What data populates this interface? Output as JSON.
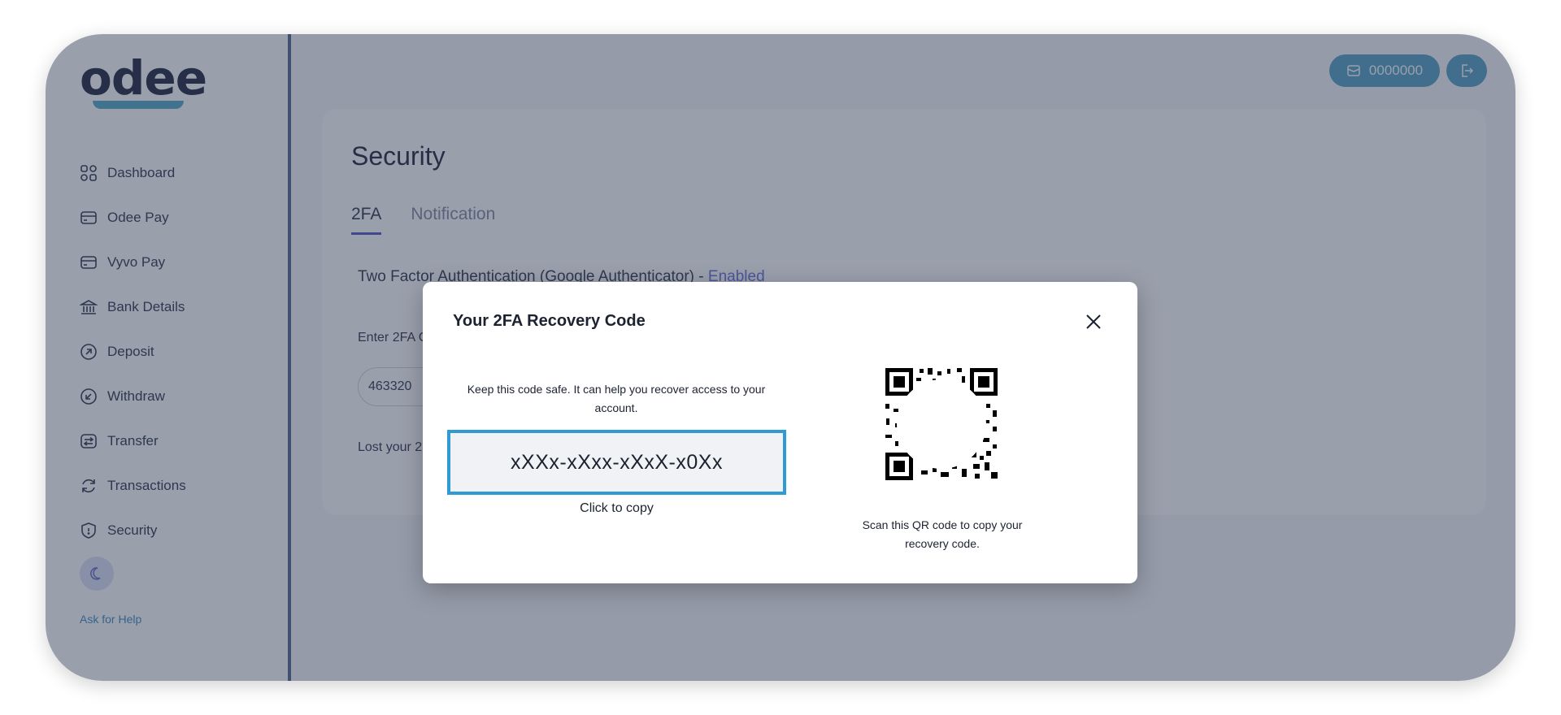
{
  "app": {
    "logo_text": "odee"
  },
  "sidebar": {
    "items": [
      {
        "label": "Dashboard",
        "icon": "grid-icon"
      },
      {
        "label": "Odee Pay",
        "icon": "card-icon"
      },
      {
        "label": "Vyvo Pay",
        "icon": "card-icon"
      },
      {
        "label": "Bank Details",
        "icon": "bank-icon"
      },
      {
        "label": "Deposit",
        "icon": "deposit-icon"
      },
      {
        "label": "Withdraw",
        "icon": "withdraw-icon"
      },
      {
        "label": "Transfer",
        "icon": "transfer-icon"
      },
      {
        "label": "Transactions",
        "icon": "refresh-icon"
      },
      {
        "label": "Security",
        "icon": "shield-icon"
      }
    ],
    "ask_help": "Ask for Help"
  },
  "header": {
    "balance": "0000000"
  },
  "main": {
    "title": "Security",
    "tabs": [
      {
        "label": "2FA",
        "active": true
      },
      {
        "label": "Notification",
        "active": false
      }
    ],
    "twofa_status_text": "Two Factor Authentication (Google Authenticator) - ",
    "twofa_status_value": "Enabled",
    "enter_label": "Enter 2FA C",
    "code_value": "463320",
    "lost_text": "Lost your 2"
  },
  "modal": {
    "title": "Your 2FA Recovery Code",
    "description": "Keep this code safe. It can help you recover access to your account.",
    "recovery_code": "xXXx-xXxx-xXxX-x0Xx",
    "copy_hint": "Click to copy",
    "qr_hint": "Scan this QR code to copy your recovery code."
  },
  "colors": {
    "accent": "#2f9ad3",
    "header_button": "#5ba7c5",
    "enabled": "#6e7ae0",
    "tab_underline": "#5a63c9"
  }
}
